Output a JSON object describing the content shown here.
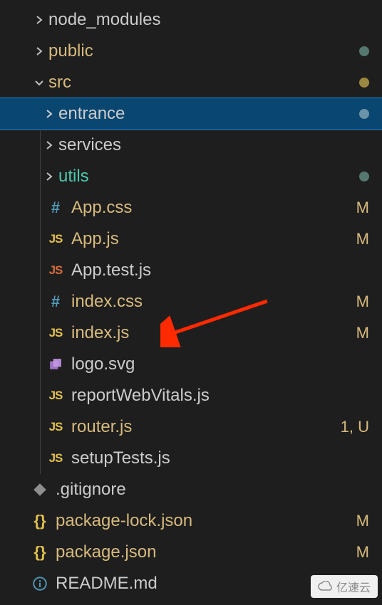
{
  "tree": {
    "node_modules": {
      "label": "node_modules"
    },
    "public": {
      "label": "public"
    },
    "src": {
      "label": "src"
    },
    "entrance": {
      "label": "entrance"
    },
    "services": {
      "label": "services"
    },
    "utils": {
      "label": "utils"
    },
    "app_css": {
      "label": "App.css",
      "status": "M"
    },
    "app_js": {
      "label": "App.js",
      "status": "M"
    },
    "app_test_js": {
      "label": "App.test.js"
    },
    "index_css": {
      "label": "index.css",
      "status": "M"
    },
    "index_js": {
      "label": "index.js",
      "status": "M"
    },
    "logo_svg": {
      "label": "logo.svg"
    },
    "report_web_vitals": {
      "label": "reportWebVitals.js"
    },
    "router_js": {
      "label": "router.js",
      "status": "1, U"
    },
    "setup_tests": {
      "label": "setupTests.js"
    },
    "gitignore": {
      "label": ".gitignore"
    },
    "pkg_lock": {
      "label": "package-lock.json",
      "status": "M"
    },
    "pkg": {
      "label": "package.json",
      "status": "M"
    },
    "readme": {
      "label": "README.md"
    }
  },
  "watermark": "亿速云"
}
